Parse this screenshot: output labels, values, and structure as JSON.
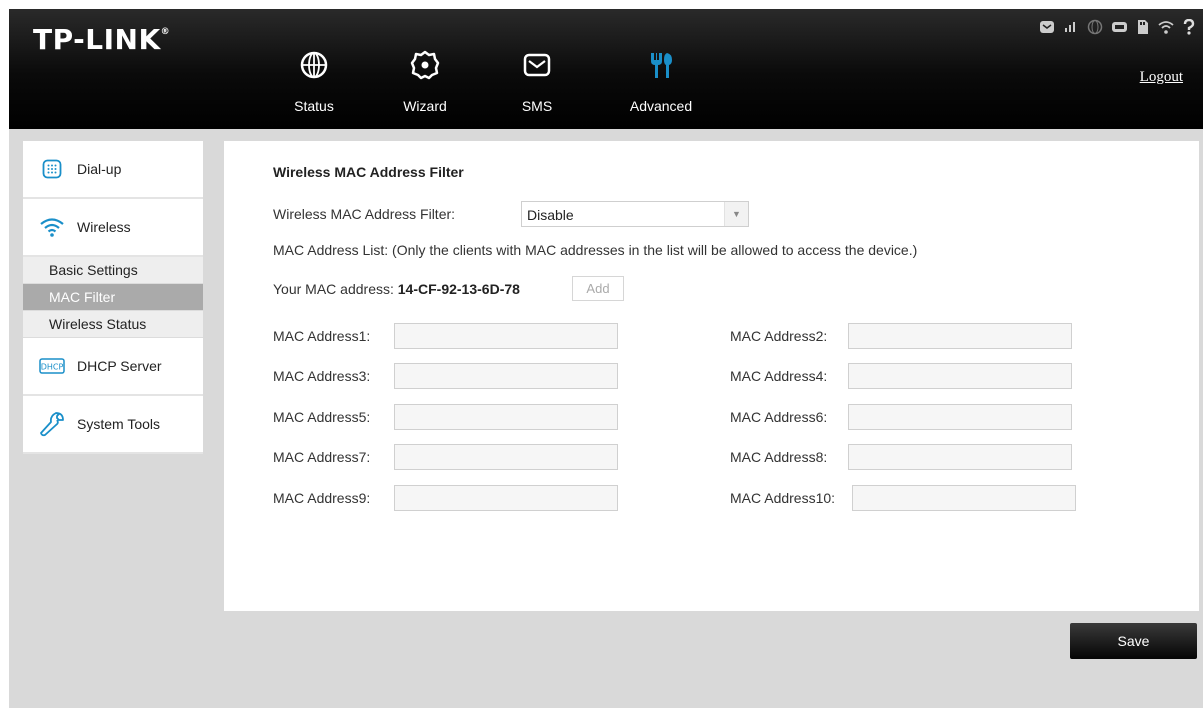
{
  "header": {
    "logo": "TP-LINK",
    "logo_mark": "®",
    "logout": "Logout",
    "nav": [
      {
        "label": "Status",
        "icon": "globe-icon"
      },
      {
        "label": "Wizard",
        "icon": "wizard-icon"
      },
      {
        "label": "SMS",
        "icon": "envelope-icon"
      },
      {
        "label": "Advanced",
        "icon": "tools-icon",
        "active": true
      }
    ],
    "status_icons": [
      "sms-message-icon",
      "signal-icon",
      "internet-icon",
      "battery-icon",
      "sd-card-icon",
      "wifi-icon",
      "help-icon"
    ],
    "accent_color": "#1a8fc9"
  },
  "sidebar": {
    "items": [
      {
        "label": "Dial-up",
        "icon": "dialpad-icon"
      },
      {
        "label": "Wireless",
        "icon": "wifi-icon"
      },
      {
        "label": "DHCP Server",
        "icon": "dhcp-icon"
      },
      {
        "label": "System Tools",
        "icon": "wrench-icon"
      }
    ],
    "wireless_sub": [
      {
        "label": "Basic Settings"
      },
      {
        "label": "MAC Filter",
        "active": true
      },
      {
        "label": "Wireless Status"
      }
    ]
  },
  "main": {
    "title": "Wireless MAC Address Filter",
    "filter_label": "Wireless MAC Address Filter:",
    "filter_value": "Disable",
    "list_note": "MAC Address List: (Only the clients with MAC addresses in the list will be allowed to access the device.)",
    "your_mac_label": "Your MAC address: ",
    "your_mac_value": "14-CF-92-13-6D-78",
    "add_label": "Add",
    "mac_fields": [
      {
        "label": "MAC Address1:",
        "value": ""
      },
      {
        "label": "MAC Address2:",
        "value": ""
      },
      {
        "label": "MAC Address3:",
        "value": ""
      },
      {
        "label": "MAC Address4:",
        "value": ""
      },
      {
        "label": "MAC Address5:",
        "value": ""
      },
      {
        "label": "MAC Address6:",
        "value": ""
      },
      {
        "label": "MAC Address7:",
        "value": ""
      },
      {
        "label": "MAC Address8:",
        "value": ""
      },
      {
        "label": "MAC Address9:",
        "value": ""
      },
      {
        "label": "MAC Address10:",
        "value": ""
      }
    ],
    "save_label": "Save"
  }
}
